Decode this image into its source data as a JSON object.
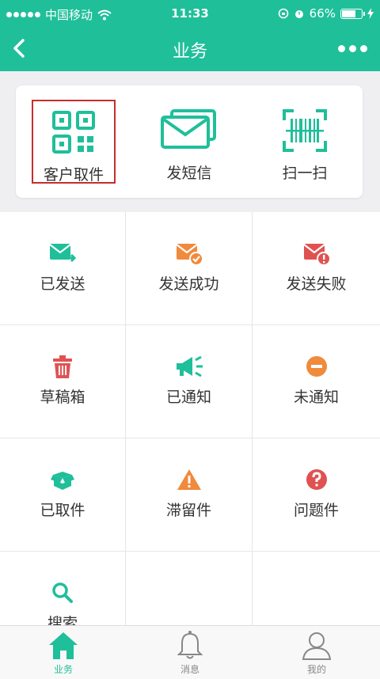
{
  "status_bar": {
    "carrier": "中国移动",
    "time": "11:33",
    "battery": "66%"
  },
  "header": {
    "title": "业务"
  },
  "quick_actions": [
    {
      "label": "客户取件",
      "icon": "qr-code-icon"
    },
    {
      "label": "发短信",
      "icon": "envelope-icon"
    },
    {
      "label": "扫一扫",
      "icon": "barcode-scan-icon"
    }
  ],
  "grid": [
    {
      "label": "已发送",
      "icon": "mail-sent-icon"
    },
    {
      "label": "发送成功",
      "icon": "mail-success-icon"
    },
    {
      "label": "发送失败",
      "icon": "mail-failed-icon"
    },
    {
      "label": "草稿箱",
      "icon": "trash-icon"
    },
    {
      "label": "已通知",
      "icon": "megaphone-icon"
    },
    {
      "label": "未通知",
      "icon": "minus-circle-icon"
    },
    {
      "label": "已取件",
      "icon": "open-box-icon"
    },
    {
      "label": "滞留件",
      "icon": "warning-icon"
    },
    {
      "label": "问题件",
      "icon": "question-icon"
    },
    {
      "label": "搜索",
      "icon": "search-icon"
    }
  ],
  "tabs": [
    {
      "label": "业务",
      "icon": "home-icon",
      "active": true
    },
    {
      "label": "消息",
      "icon": "bell-icon"
    },
    {
      "label": "我的",
      "icon": "user-icon"
    }
  ],
  "colors": {
    "accent": "#1fbf9a",
    "orange": "#f08a3c",
    "red": "#e05252",
    "highlight": "#c72d2d"
  }
}
